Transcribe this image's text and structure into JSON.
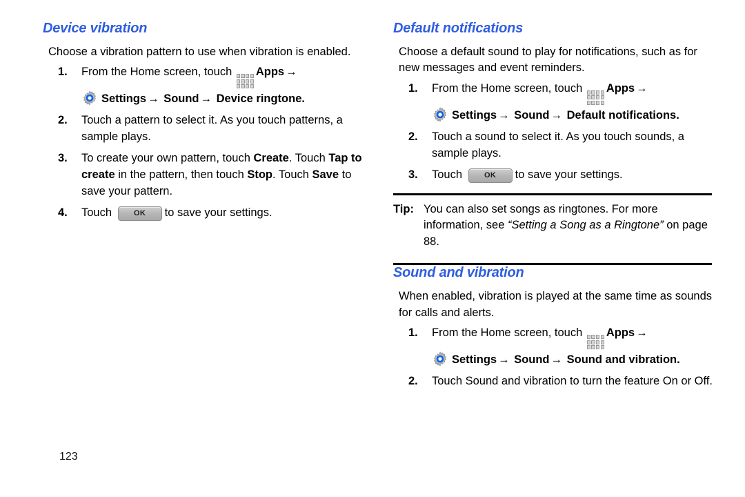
{
  "page": {
    "number": "123"
  },
  "icons": {
    "apps": "apps-grid-icon",
    "settings": "settings-gear-icon",
    "ok_button_label": "OK",
    "arrow": "→"
  },
  "colors": {
    "heading": "#2f5de0",
    "text": "#000000",
    "rule": "#000000",
    "gear_blue": "#1565e0",
    "apps_cell": "#d4d4d4"
  },
  "left_column": {
    "heading": "Device vibration",
    "intro": "Choose a vibration pattern to use when vibration is enabled.",
    "steps": [
      {
        "num": "1.",
        "text_before_apps": "From the Home screen, touch ",
        "apps_label": "Apps",
        "path": [
          "Settings",
          "Sound",
          "Device ringtone"
        ],
        "path_suffix": "."
      },
      {
        "num": "2.",
        "text": "Touch a pattern to select it. As you touch patterns, a sample plays."
      },
      {
        "num": "3.",
        "parts": [
          {
            "t": "To create your own pattern, touch ",
            "b": false
          },
          {
            "t": "Create",
            "b": true
          },
          {
            "t": ". Touch ",
            "b": false
          },
          {
            "t": "Tap to create",
            "b": true
          },
          {
            "t": " in the pattern, then touch ",
            "b": false
          },
          {
            "t": "Stop",
            "b": true
          },
          {
            "t": ". Touch ",
            "b": false
          },
          {
            "t": "Save",
            "b": true
          },
          {
            "t": " to save your pattern.",
            "b": false
          }
        ]
      },
      {
        "num": "4.",
        "text_before_ok": "Touch ",
        "text_after_ok": "to save your settings."
      }
    ]
  },
  "right_column": {
    "section_one": {
      "heading": "Default notifications",
      "intro": "Choose a default sound to play for notifications, such as for new messages and event reminders.",
      "steps": [
        {
          "num": "1.",
          "text_before_apps": "From the Home screen, touch ",
          "apps_label": "Apps",
          "path": [
            "Settings",
            "Sound",
            "Default notifications"
          ],
          "path_suffix": "."
        },
        {
          "num": "2.",
          "text": "Touch a sound to select it. As you touch sounds, a sample plays."
        },
        {
          "num": "3.",
          "text_before_ok": "Touch ",
          "text_after_ok": "to save your settings."
        }
      ]
    },
    "tip": {
      "label": "Tip:",
      "text_before_italic": "You can also set songs as ringtones. For more information, see ",
      "italic_text": "“Setting a Song as a Ringtone”",
      "text_after_italic": " on page 88."
    },
    "section_two": {
      "heading": "Sound and vibration",
      "intro": "When enabled, vibration is played at the same time as sounds for calls and alerts.",
      "steps": [
        {
          "num": "1.",
          "text_before_apps": "From the Home screen, touch ",
          "apps_label": "Apps",
          "path": [
            "Settings",
            "Sound",
            "Sound and vibration"
          ],
          "path_suffix": "."
        },
        {
          "num": "2.",
          "text": "Touch Sound and vibration to turn the feature On or Off."
        }
      ]
    }
  }
}
